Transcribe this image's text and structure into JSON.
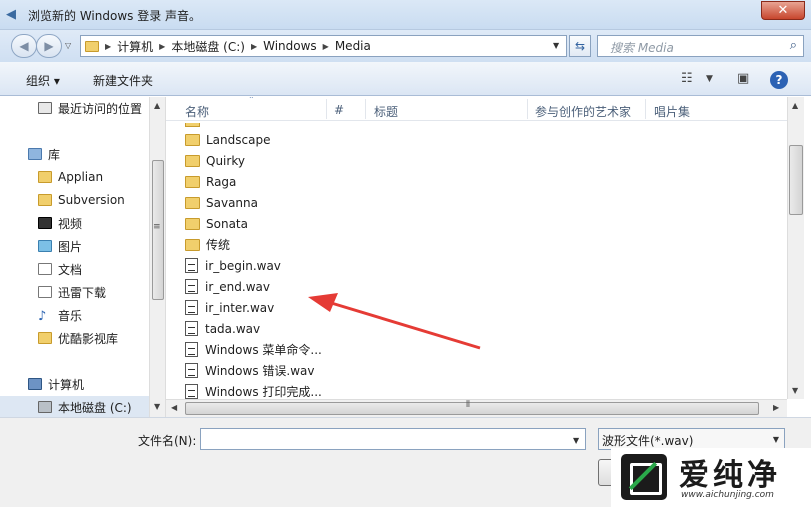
{
  "window": {
    "title": "浏览新的 Windows 登录 声音。",
    "close_glyph": "✕"
  },
  "address": {
    "crumbs": [
      "计算机",
      "本地磁盘 (C:)",
      "Windows",
      "Media"
    ],
    "search_placeholder": "搜索 Media"
  },
  "toolbar": {
    "organize": "组织 ▾",
    "new_folder": "新建文件夹"
  },
  "sidebar": {
    "items": [
      {
        "label": "最近访问的位置",
        "icon": "recent-places-icon"
      },
      {
        "label": "库",
        "icon": "library-icon"
      },
      {
        "label": "Applian",
        "icon": "folder-icon"
      },
      {
        "label": "Subversion",
        "icon": "folder-icon"
      },
      {
        "label": "视频",
        "icon": "video-library-icon"
      },
      {
        "label": "图片",
        "icon": "pictures-library-icon"
      },
      {
        "label": "文档",
        "icon": "documents-library-icon"
      },
      {
        "label": "迅雷下载",
        "icon": "download-folder-icon"
      },
      {
        "label": "音乐",
        "icon": "music-library-icon"
      },
      {
        "label": "优酷影视库",
        "icon": "folder-icon"
      },
      {
        "label": "计算机",
        "icon": "computer-icon"
      },
      {
        "label": "本地磁盘 (C:)",
        "icon": "local-disk-icon"
      }
    ]
  },
  "columns": {
    "name": "名称",
    "number": "#",
    "title": "标题",
    "artists": "参与创作的艺术家",
    "album": "唱片集"
  },
  "files": [
    {
      "name": "Landscape",
      "type": "folder"
    },
    {
      "name": "Quirky",
      "type": "folder"
    },
    {
      "name": "Raga",
      "type": "folder"
    },
    {
      "name": "Savanna",
      "type": "folder"
    },
    {
      "name": "Sonata",
      "type": "folder"
    },
    {
      "name": "传统",
      "type": "folder"
    },
    {
      "name": "ir_begin.wav",
      "type": "wav"
    },
    {
      "name": "ir_end.wav",
      "type": "wav"
    },
    {
      "name": "ir_inter.wav",
      "type": "wav"
    },
    {
      "name": "tada.wav",
      "type": "wav"
    },
    {
      "name": "Windows 菜单命令...",
      "type": "wav"
    },
    {
      "name": "Windows 错误.wav",
      "type": "wav"
    },
    {
      "name": "Windows 打印完成...",
      "type": "wav"
    }
  ],
  "bottom": {
    "filename_label": "文件名(N):",
    "filename_value": "",
    "filetype": "波形文件(*.wav)"
  },
  "watermark": {
    "text": "爱纯净",
    "url": "www.aichunjing.com"
  },
  "colors": {
    "annotation_arrow": "#e53b35"
  }
}
